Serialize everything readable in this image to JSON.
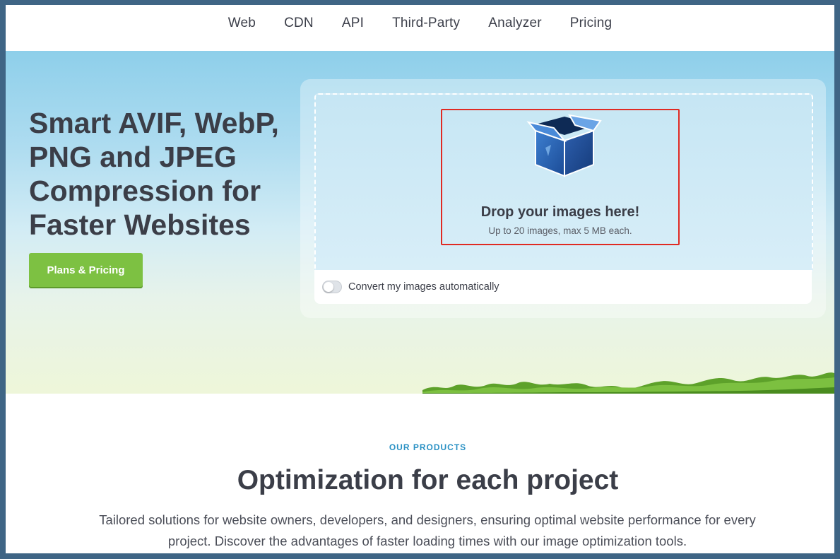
{
  "nav": {
    "items": [
      {
        "label": "Web"
      },
      {
        "label": "CDN"
      },
      {
        "label": "API"
      },
      {
        "label": "Third-Party"
      },
      {
        "label": "Analyzer"
      },
      {
        "label": "Pricing"
      }
    ]
  },
  "hero": {
    "title": "Smart AVIF, WebP, PNG and JPEG Compression for Faster Websites",
    "cta_label": "Plans & Pricing"
  },
  "upload": {
    "icon": "open-box-icon",
    "title": "Drop your images here!",
    "subtitle": "Up to 20 images, max 5 MB each.",
    "convert_label": "Convert my images automatically",
    "convert_enabled": false
  },
  "products": {
    "eyebrow": "OUR PRODUCTS",
    "title": "Optimization for each project",
    "description": "Tailored solutions for website owners, developers, and designers, ensuring optimal website performance for every project. Discover the advantages of faster loading times with our image optimization tools."
  },
  "colors": {
    "cta": "#7dc142",
    "eyebrow": "#2a91c4",
    "highlight": "#e02a23",
    "text_dark": "#3b3e48"
  }
}
